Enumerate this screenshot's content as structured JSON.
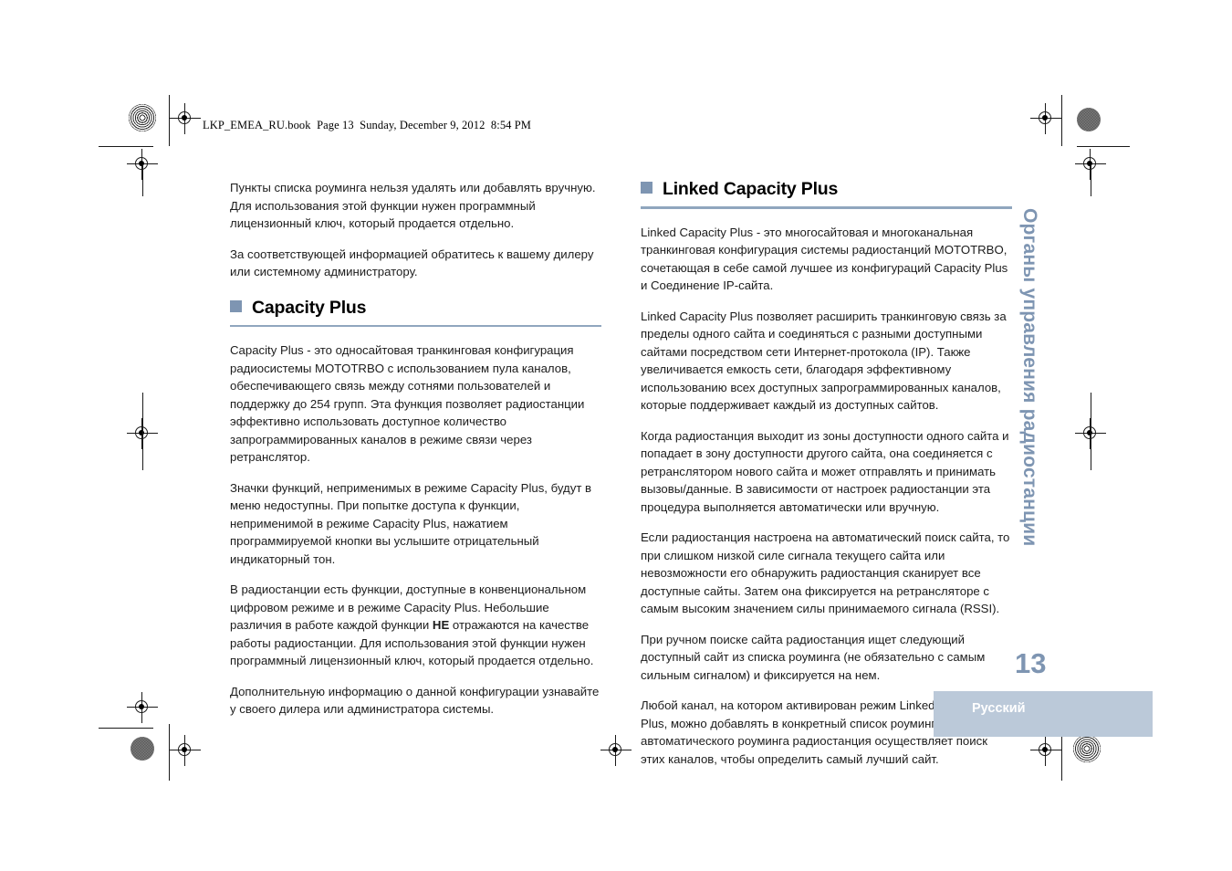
{
  "header": {
    "book_line": "LKP_EMEA_RU.book  Page 13  Sunday, December 9, 2012  8:54 PM"
  },
  "left_column": {
    "intro_paragraphs": [
      "Пункты списка роуминга нельзя удалять или добавлять вручную. Для использования этой функции нужен программный лицензионный ключ, который продается отдельно.",
      "За соответствующей информацией обратитесь к вашему дилеру или системному администратору."
    ],
    "section": {
      "title": "Capacity Plus",
      "paragraphs": [
        "Capacity Plus - это односайтовая транкинговая конфигурация радиосистемы MOTOTRBO с использованием пула каналов, обеспечивающего связь между сотнями пользователей и поддержку до 254 групп. Эта функция позволяет радиостанции эффективно использовать доступное количество запрограммированных каналов в режиме связи через ретранслятор.",
        "Значки функций, неприменимых в режиме Capacity Plus, будут в меню недоступны. При попытке доступа к функции, неприменимой в режиме Capacity Plus, нажатием программируемой кнопки вы услышите отрицательный индикаторный тон."
      ],
      "paragraph_with_bold": {
        "before": "В радиостанции есть функции, доступные в конвенциональном цифровом режиме и в режиме Capacity Plus. Небольшие различия в работе каждой функции ",
        "bold": "НЕ",
        "after": " отражаются на качестве работы радиостанции. Для использования этой функции нужен программный лицензионный ключ, который продается отдельно."
      },
      "closing_paragraph": "Дополнительную информацию о данной конфигурации узнавайте у своего дилера или администратора системы."
    }
  },
  "right_column": {
    "section": {
      "title": "Linked Capacity Plus",
      "paragraphs": [
        "Linked Capacity Plus - это многосайтовая и многоканальная транкинговая конфигурация системы радиостанций MOTOTRBO, сочетающая в себе самой лучшее из конфигураций Capacity Plus и Соединение IP-сайта.",
        "Linked Capacity Plus позволяет расширить транкинговую связь за пределы одного сайта и соединяться с разными доступными сайтами посредством сети Интернет-протокола (IP). Также увеличивается емкость сети, благодаря эффективному использованию всех доступных запрограммированных каналов, которые поддерживает каждый из доступных сайтов.",
        "Когда радиостанция выходит из зоны доступности одного сайта и попадает в зону доступности другого сайта, она соединяется с ретранслятором нового сайта и может отправлять и принимать вызовы/данные. В зависимости от настроек радиостанции эта процедура выполняется автоматически или вручную.",
        "Если радиостанция настроена на автоматический поиск сайта, то при слишком низкой силе сигнала текущего сайта или невозможности его обнаружить радиостанция сканирует все доступные сайты. Затем она фиксируется на ретрансляторе с самым высоким значением силы принимаемого сигнала (RSSI).",
        "При ручном поиске сайта радиостанция ищет следующий доступный сайт из списка роуминга (не обязательно с самым сильным сигналом) и фиксируется на нем.",
        "Любой канал, на котором активирован режим Linked Capacity Plus, можно добавлять в конкретный список роуминга. Во время автоматического роуминга радиостанция осуществляет поиск этих каналов, чтобы определить самый лучший сайт."
      ]
    }
  },
  "side_tab": {
    "label": "Органы управления радиостанции"
  },
  "footer": {
    "page_number": "13",
    "language": "Русский"
  },
  "colors": {
    "accent_blue_gray": "#7e95b2",
    "rule_blue_gray": "#90a6be",
    "band_blue_gray": "#bbc9d9",
    "text_black": "#1c1c1c"
  }
}
